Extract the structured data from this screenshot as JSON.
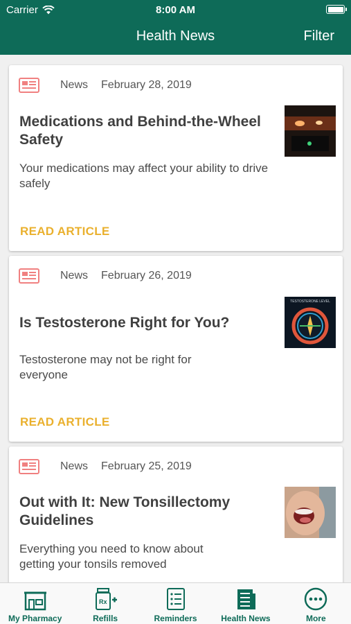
{
  "status_bar": {
    "carrier": "Carrier",
    "time": "8:00 AM"
  },
  "nav": {
    "title": "Health News",
    "filter_label": "Filter"
  },
  "articles": [
    {
      "category": "News",
      "date": "February 28, 2019",
      "title": "Medications and Behind-the-Wheel Safety",
      "description": "Your medications may affect your ability to drive safely",
      "action": "READ ARTICLE"
    },
    {
      "category": "News",
      "date": "February 26, 2019",
      "title": "Is Testosterone Right for You?",
      "description": "Testosterone may not be right for everyone",
      "action": "READ ARTICLE",
      "thumb_caption": "TESTOSTERONE LEVEL"
    },
    {
      "category": "News",
      "date": "February 25, 2019",
      "title": "Out with It: New Tonsillectomy Guidelines",
      "description": "Everything you need to know about getting your tonsils removed"
    }
  ],
  "tabs": [
    {
      "label": "My Pharmacy",
      "icon": "pharmacy-storefront-icon"
    },
    {
      "label": "Refills",
      "icon": "rx-bottle-plus-icon"
    },
    {
      "label": "Reminders",
      "icon": "checklist-icon"
    },
    {
      "label": "Health News",
      "icon": "newspaper-icon"
    },
    {
      "label": "More",
      "icon": "more-dots-icon"
    }
  ],
  "colors": {
    "brand": "#0e6b58",
    "accent": "#eab02d",
    "news_icon": "#f08080"
  }
}
